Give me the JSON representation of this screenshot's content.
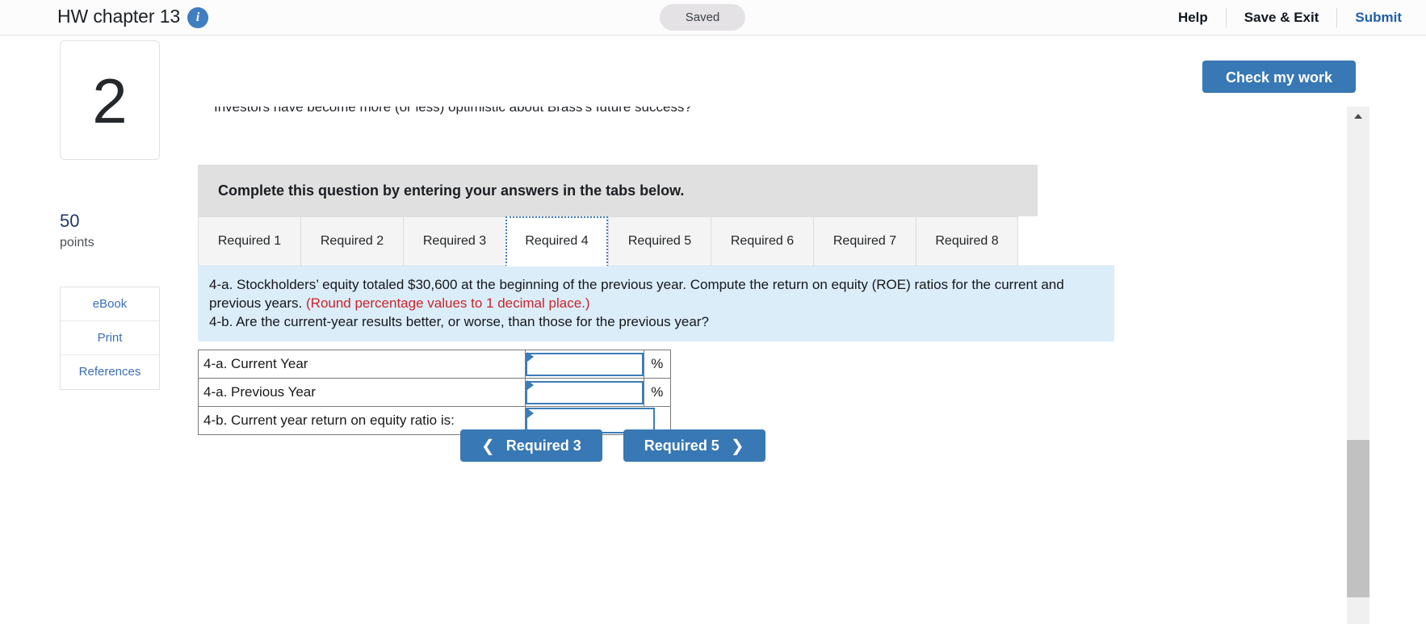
{
  "header": {
    "title": "HW chapter 13",
    "info_icon": "info-icon",
    "status": "Saved",
    "help_label": "Help",
    "save_exit_label": "Save & Exit",
    "submit_label": "Submit"
  },
  "rail": {
    "question_number": "2",
    "points_value": "50",
    "points_label": "points",
    "buttons": [
      {
        "label": "eBook"
      },
      {
        "label": "Print"
      },
      {
        "label": "References"
      }
    ]
  },
  "toolbar": {
    "check_my_work_label": "Check my work"
  },
  "main": {
    "clipped_question_line": "Investors have become more (or less) optimistic about Brass's future success?",
    "instruction_banner": "Complete this question by entering your answers in the tabs below.",
    "tabs": [
      {
        "label": "Required 1",
        "active": false
      },
      {
        "label": "Required 2",
        "active": false
      },
      {
        "label": "Required 3",
        "active": false
      },
      {
        "label": "Required 4",
        "active": true
      },
      {
        "label": "Required 5",
        "active": false
      },
      {
        "label": "Required 6",
        "active": false
      },
      {
        "label": "Required 7",
        "active": false
      },
      {
        "label": "Required 8",
        "active": false
      }
    ],
    "panel": {
      "line1_part1": "4-a. Stockholders’ equity totaled $30,600 at the beginning of the previous year. Compute the return on equity (ROE) ratios for the current and previous years. ",
      "line1_rounding": "(Round percentage values to 1 decimal place.)",
      "line2": "4-b. Are the current-year results better, or worse, than those for the previous year?"
    },
    "answers": {
      "rows": [
        {
          "label": "4-a. Current Year",
          "value": "",
          "unit": "%"
        },
        {
          "label": "4-a. Previous Year",
          "value": "",
          "unit": "%"
        },
        {
          "label": "4-b. Current year return on equity ratio is:",
          "value": "",
          "unit": ""
        }
      ]
    },
    "nav": {
      "prev_label": "Required 3",
      "prev_icon": "chevron-left-icon",
      "next_label": "Required 5",
      "next_icon": "chevron-right-icon"
    }
  },
  "colors": {
    "accent_blue": "#3878b4",
    "panel_blue": "#dbedf9",
    "banner_gray": "#e0e0e0",
    "link_blue": "#3a6fb5",
    "red_note": "#c9242a"
  }
}
